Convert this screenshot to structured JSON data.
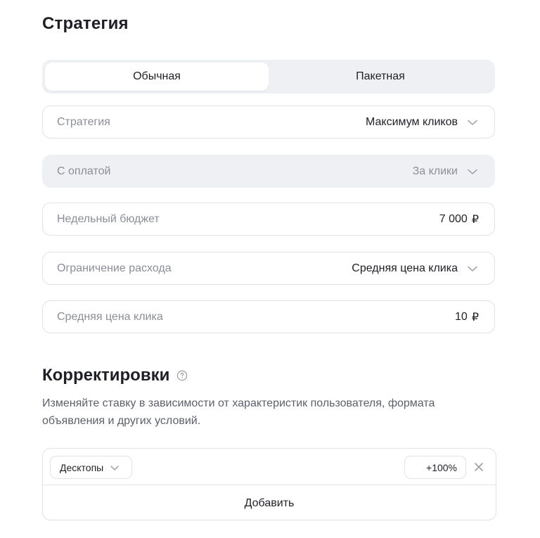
{
  "strategy_section": {
    "title": "Стратегия",
    "tabs": [
      "Обычная",
      "Пакетная"
    ],
    "selected_tab": "Обычная",
    "fields": {
      "strategy": {
        "label": "Стратегия",
        "value": "Максимум кликов"
      },
      "payment": {
        "label": "С оплатой",
        "value": "За клики"
      },
      "weekly_budget": {
        "label": "Недельный бюджет",
        "value": "7 000",
        "unit": "₽"
      },
      "spend_limit": {
        "label": "Ограничение расхода",
        "value": "Средняя цена клика"
      },
      "avg_click_price": {
        "label": "Средняя цена клика",
        "value": "10",
        "unit": "₽"
      }
    }
  },
  "adjustments": {
    "title": "Корректировки",
    "description": "Изменяйте ставку в зависимости от характеристик пользователя, формата объявления и других условий.",
    "items": [
      {
        "type": "Десктопы",
        "percent": "+100%"
      }
    ],
    "add_label": "Добавить"
  },
  "colors": {
    "text": "#1f2026",
    "muted": "#8b8e99",
    "border": "#e0e2e8",
    "segment_bg": "#eef0f4"
  },
  "icons": {
    "dropdown": "chevron-down-icon",
    "help": "question-circle-icon",
    "remove": "close-icon"
  }
}
